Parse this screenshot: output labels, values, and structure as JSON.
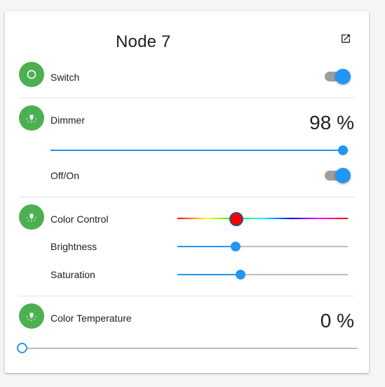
{
  "card": {
    "title": "Node 7"
  },
  "entities": [
    {
      "name": "Switch",
      "state": "on"
    },
    {
      "name": "Dimmer",
      "value_display": "98 %",
      "level": 0.98,
      "sub_label": "Off/On",
      "sub_state": "on"
    },
    {
      "name": "Color Control",
      "hue_position": 0.34,
      "brightness_label": "Brightness",
      "brightness_level": 0.34,
      "saturation_label": "Saturation",
      "saturation_level": 0.37
    },
    {
      "name": "Color Temperature",
      "value_display": "0 %",
      "level": 0.0
    }
  ],
  "colors": {
    "icon_bg": "#4caf50",
    "accent": "#2196f3",
    "hue_thumb": "#ff0000"
  },
  "icons": {
    "open": "open-in-new-icon",
    "switch": "power-circle-icon",
    "light": "lightbulb-icon"
  }
}
